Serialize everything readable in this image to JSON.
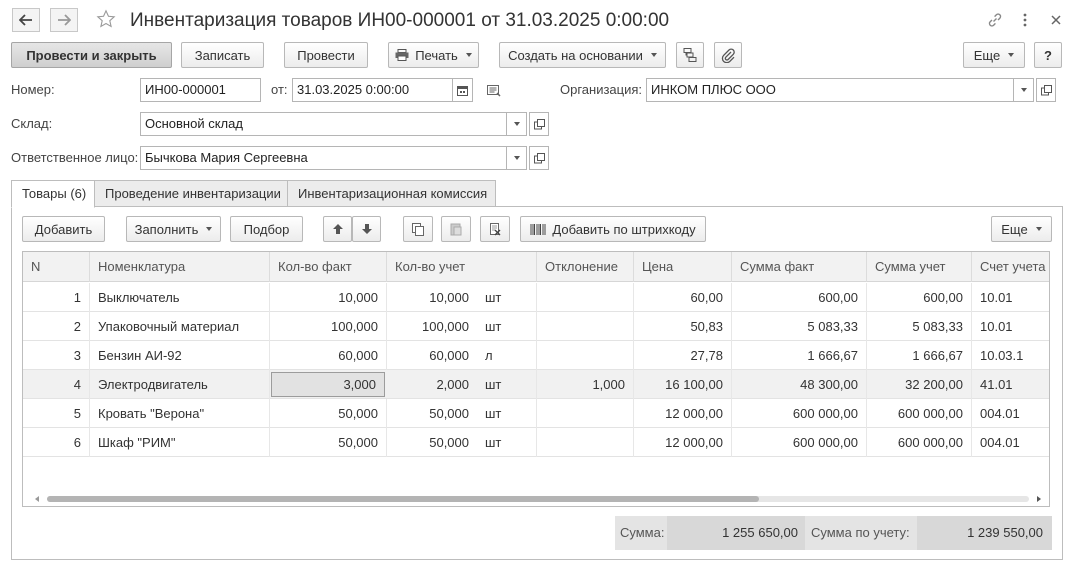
{
  "title": "Инвентаризация товаров ИН00-000001 от 31.03.2025 0:00:00",
  "toolbar": {
    "post_close": "Провести и закрыть",
    "write": "Записать",
    "post": "Провести",
    "print": "Печать",
    "create_based": "Создать на основании",
    "more": "Еще",
    "help": "?"
  },
  "form": {
    "number_label": "Номер:",
    "number_value": "ИН00-000001",
    "date_label": "от:",
    "date_value": "31.03.2025  0:00:00",
    "org_label": "Организация:",
    "org_value": "ИНКОМ ПЛЮС ООО",
    "warehouse_label": "Склад:",
    "warehouse_value": "Основной склад",
    "responsible_label": "Ответственное лицо:",
    "responsible_value": "Бычкова Мария Сергеевна"
  },
  "tabs": [
    {
      "label": "Товары (6)"
    },
    {
      "label": "Проведение инвентаризации"
    },
    {
      "label": "Инвентаризационная комиссия"
    }
  ],
  "grid_toolbar": {
    "add": "Добавить",
    "fill": "Заполнить",
    "pick": "Подбор",
    "add_barcode": "Добавить по штрихкоду",
    "more": "Еще"
  },
  "table": {
    "columns": [
      "N",
      "Номенклатура",
      "Кол-во факт",
      "Кол-во учет",
      "Отклонение",
      "Цена",
      "Сумма факт",
      "Сумма учет",
      "Счет учета"
    ],
    "rows": [
      {
        "n": "1",
        "name": "Выключатель",
        "qty_fact": "10,000",
        "qty_acc": "10,000",
        "unit": "шт",
        "dev": "",
        "price": "60,00",
        "sum_fact": "600,00",
        "sum_acc": "600,00",
        "account": "10.01"
      },
      {
        "n": "2",
        "name": "Упаковочный материал",
        "qty_fact": "100,000",
        "qty_acc": "100,000",
        "unit": "шт",
        "dev": "",
        "price": "50,83",
        "sum_fact": "5 083,33",
        "sum_acc": "5 083,33",
        "account": "10.01"
      },
      {
        "n": "3",
        "name": "Бензин АИ-92",
        "qty_fact": "60,000",
        "qty_acc": "60,000",
        "unit": "л",
        "dev": "",
        "price": "27,78",
        "sum_fact": "1 666,67",
        "sum_acc": "1 666,67",
        "account": "10.03.1"
      },
      {
        "n": "4",
        "name": "Электродвигатель",
        "qty_fact": "3,000",
        "qty_acc": "2,000",
        "unit": "шт",
        "dev": "1,000",
        "price": "16 100,00",
        "sum_fact": "48 300,00",
        "sum_acc": "32 200,00",
        "account": "41.01"
      },
      {
        "n": "5",
        "name": "Кровать \"Верона\"",
        "qty_fact": "50,000",
        "qty_acc": "50,000",
        "unit": "шт",
        "dev": "",
        "price": "12 000,00",
        "sum_fact": "600 000,00",
        "sum_acc": "600 000,00",
        "account": "004.01"
      },
      {
        "n": "6",
        "name": "Шкаф \"РИМ\"",
        "qty_fact": "50,000",
        "qty_acc": "50,000",
        "unit": "шт",
        "dev": "",
        "price": "12 000,00",
        "sum_fact": "600 000,00",
        "sum_acc": "600 000,00",
        "account": "004.01"
      }
    ]
  },
  "totals": {
    "sum_label": "Сумма:",
    "sum_value": "1 255 650,00",
    "sum_acc_label": "Сумма по учету:",
    "sum_acc_value": "1 239 550,00"
  }
}
